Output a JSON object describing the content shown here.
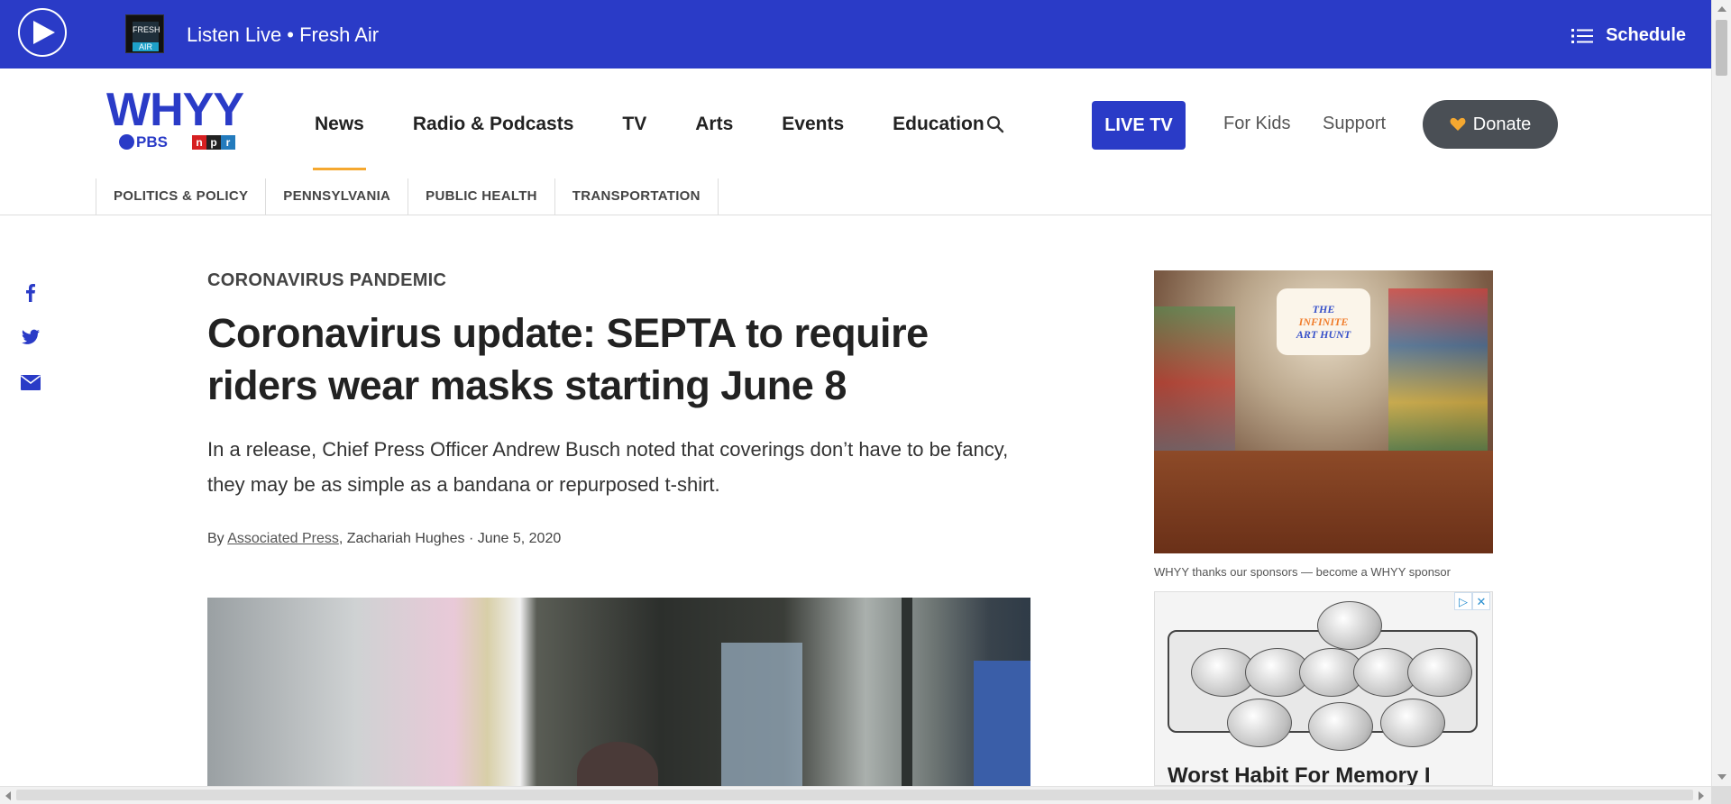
{
  "livebar": {
    "text": "Listen Live • Fresh Air",
    "thumb_line1": "FRESH",
    "thumb_line2": "AIR",
    "schedule_label": "Schedule",
    "color": "#2a3bc7"
  },
  "logo": {
    "name": "WHYY",
    "pbs": "PBS",
    "npr": [
      "n",
      "p",
      "r"
    ]
  },
  "nav": {
    "items": [
      "News",
      "Radio & Podcasts",
      "TV",
      "Arts",
      "Events",
      "Education"
    ],
    "active": "News",
    "live_tv": "LIVE TV",
    "for_kids": "For Kids",
    "support": "Support",
    "donate": "Donate"
  },
  "subnav": {
    "items": [
      "POLITICS & POLICY",
      "PENNSYLVANIA",
      "PUBLIC HEALTH",
      "TRANSPORTATION"
    ]
  },
  "share": {
    "icons": [
      "facebook-icon",
      "twitter-icon",
      "email-icon"
    ]
  },
  "article": {
    "kicker": "CORONAVIRUS PANDEMIC",
    "headline": "Coronavirus update: SEPTA to require riders wear masks starting June 8",
    "dek": "In a release, Chief Press Officer Andrew Busch noted that coverings don’t have to be fancy, they may be as simple as a bandana or repurposed t-shirt.",
    "byline_prefix": "By",
    "author1": "Associated Press",
    "author2": ", Zachariah Hughes",
    "separator": "·",
    "date": "June 5, 2020"
  },
  "sponsors": {
    "ad1_logo_line1": "THE",
    "ad1_logo_line2": "INFINITE",
    "ad1_logo_line3": "ART HUNT",
    "note": "WHYY thanks our sponsors — become a WHYY sponsor",
    "ad2_caption": "Worst Habit For Memory I"
  },
  "colors": {
    "brand_blue": "#2a3bc7",
    "active_underline": "#f5a830",
    "donate_bg": "#4a4f55"
  }
}
